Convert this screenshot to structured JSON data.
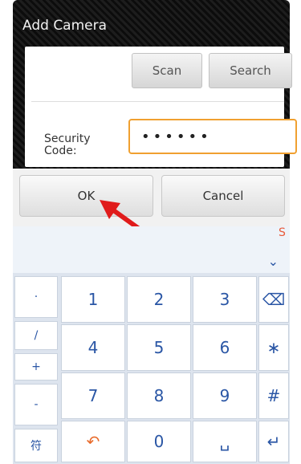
{
  "dialog": {
    "title": "Add Camera",
    "scan_label": "Scan",
    "search_label": "Search",
    "security_label": "Security\nCode:",
    "security_value": "••••••",
    "ok_label": "OK",
    "cancel_label": "Cancel"
  },
  "keyboard": {
    "collapse_icon": "⌄",
    "symbols": [
      "·",
      "/",
      "+",
      "-",
      "符"
    ],
    "rows": [
      [
        "1",
        "2",
        "3",
        "⌫"
      ],
      [
        "4",
        "5",
        "6",
        "∗"
      ],
      [
        "7",
        "8",
        "9",
        "#"
      ],
      [
        "↶",
        "0",
        "␣",
        "↵"
      ]
    ]
  },
  "colors": {
    "accent_blue": "#2a56a5",
    "focus_orange": "#f0a030",
    "arrow_red": "#e01b1b"
  }
}
